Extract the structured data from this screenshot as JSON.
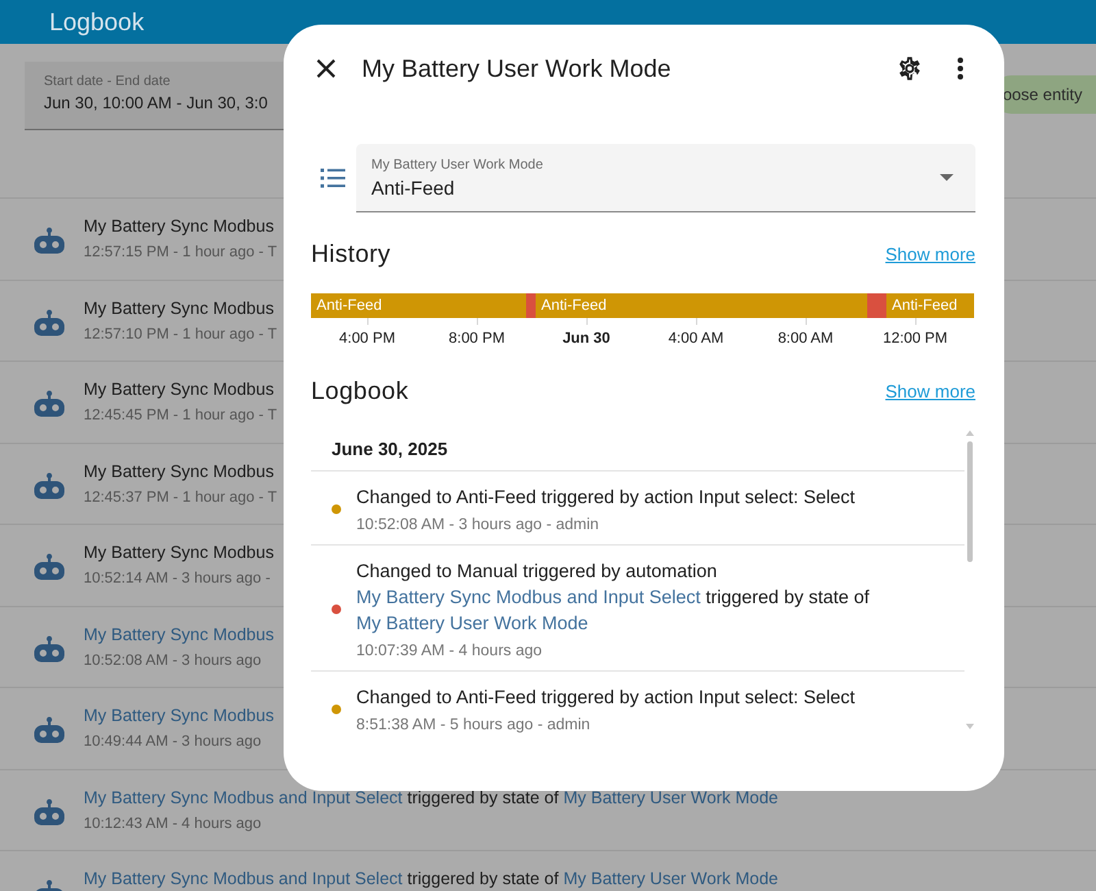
{
  "page": {
    "title": "Logbook",
    "date_range": {
      "label": "Start date - End date",
      "value": "Jun 30, 10:00 AM - Jun 30, 3:0"
    },
    "choose_entity_button": "oose entity"
  },
  "background_rows": [
    {
      "title": [
        {
          "kind": "text",
          "text": "My Battery Sync Modbus"
        }
      ],
      "subtitle": "12:57:15 PM - 1 hour ago - T"
    },
    {
      "title": [
        {
          "kind": "text",
          "text": "My Battery Sync Modbus"
        }
      ],
      "subtitle": "12:57:10 PM - 1 hour ago - T"
    },
    {
      "title": [
        {
          "kind": "text",
          "text": "My Battery Sync Modbus"
        }
      ],
      "subtitle": "12:45:45 PM - 1 hour ago - T"
    },
    {
      "title": [
        {
          "kind": "text",
          "text": "My Battery Sync Modbus"
        }
      ],
      "subtitle": "12:45:37 PM - 1 hour ago - T"
    },
    {
      "title": [
        {
          "kind": "text",
          "text": "My Battery Sync Modbus"
        }
      ],
      "subtitle": "10:52:14 AM - 3 hours ago -"
    },
    {
      "title": [
        {
          "kind": "link",
          "text": "My Battery Sync Modbus"
        }
      ],
      "subtitle": "10:52:08 AM - 3 hours ago"
    },
    {
      "title": [
        {
          "kind": "link",
          "text": "My Battery Sync Modbus"
        }
      ],
      "subtitle": "10:49:44 AM - 3 hours ago"
    },
    {
      "title": [
        {
          "kind": "link",
          "text": "My Battery Sync Modbus and Input Select"
        },
        {
          "kind": "text",
          "text": "triggered by state of"
        },
        {
          "kind": "link",
          "text": "My Battery User Work Mode"
        }
      ],
      "subtitle": "10:12:43 AM - 4 hours ago"
    },
    {
      "title": [
        {
          "kind": "link",
          "text": "My Battery Sync Modbus and Input Select"
        },
        {
          "kind": "text",
          "text": "triggered by state of"
        },
        {
          "kind": "link",
          "text": "My Battery User Work Mode"
        }
      ]
    }
  ],
  "dialog": {
    "title": "My Battery User Work Mode",
    "select": {
      "label": "My Battery User Work Mode",
      "value": "Anti-Feed"
    },
    "history": {
      "title": "History",
      "show_more": "Show more",
      "timeline": {
        "segments": [
          {
            "label": "Anti-Feed",
            "color": "#cf9605"
          },
          {
            "color": "#d9503f"
          },
          {
            "label": "Anti-Feed",
            "color": "#cf9605"
          },
          {
            "color": "#cf9605"
          },
          {
            "color": "#d9503f"
          },
          {
            "label": "Anti-Feed",
            "color": "#cf9605"
          }
        ],
        "axis_labels": [
          {
            "text": "4:00 PM",
            "bold": false
          },
          {
            "text": "8:00 PM",
            "bold": false
          },
          {
            "text": "Jun 30",
            "bold": true
          },
          {
            "text": "4:00 AM",
            "bold": false
          },
          {
            "text": "8:00 AM",
            "bold": false
          },
          {
            "text": "12:00 PM",
            "bold": false
          }
        ]
      }
    },
    "logbook": {
      "title": "Logbook",
      "show_more": "Show more",
      "date": "June 30, 2025",
      "entries": [
        {
          "color": "#cf9605",
          "message": [
            {
              "kind": "text",
              "text": "Changed to Anti-Feed triggered by action Input select: Select"
            }
          ],
          "meta": "10:52:08 AM - 3 hours ago - admin"
        },
        {
          "color": "#d9503f",
          "message": [
            {
              "kind": "text",
              "text": "Changed to Manual triggered by automation"
            },
            {
              "kind": "link",
              "text": "My Battery Sync Modbus and Input Select"
            },
            {
              "kind": "text",
              "text": "triggered by state of"
            },
            {
              "kind": "link",
              "text": "My Battery User Work Mode"
            }
          ],
          "meta": "10:07:39 AM - 4 hours ago"
        },
        {
          "color": "#cf9605",
          "message": [
            {
              "kind": "text",
              "text": "Changed to Anti-Feed triggered by action Input select: Select"
            }
          ],
          "meta": "8:51:38 AM - 5 hours ago - admin"
        }
      ]
    }
  }
}
